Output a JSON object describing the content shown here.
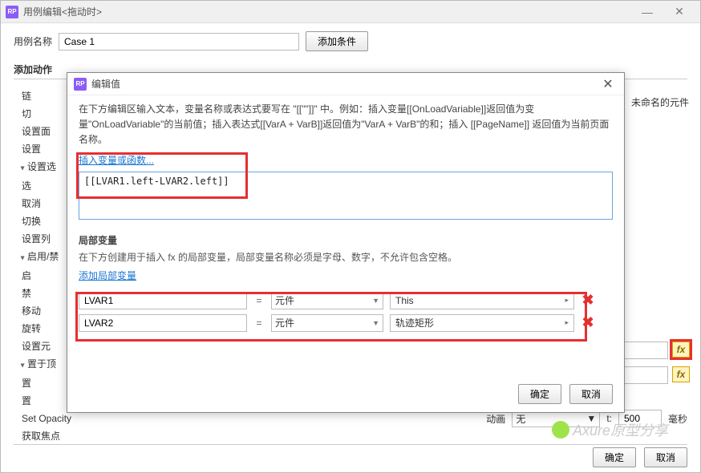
{
  "outer": {
    "title": "用例编辑<拖动时>",
    "caseNameLabel": "用例名称",
    "caseName": "Case 1",
    "addCondition": "添加条件",
    "addActionHdr": "添加动作",
    "componentsHdr": "未命名的元件",
    "ok": "确定",
    "cancel": "取消"
  },
  "tree": {
    "items": [
      "链",
      "切",
      "设置面",
      "设置",
      "设置选",
      "选",
      "取消",
      "切换",
      "设置列",
      "启用/禁",
      "启",
      "禁",
      "移动",
      "旋转",
      "设置元",
      "置于顶",
      "置",
      "置",
      "Set Opacity",
      "获取焦点"
    ]
  },
  "modal": {
    "title": "编辑值",
    "help": "在下方编辑区输入文本，变量名称或表达式要写在 \"[[\"\"]]\" 中。例如：插入变量[[OnLoadVariable]]返回值为变量\"OnLoadVariable\"的当前值；插入表达式[[VarA + VarB]]返回值为\"VarA + VarB\"的和；插入 [[PageName]] 返回值为当前页面名称。",
    "insertVarLink": "插入变量或函数...",
    "expression": "[[LVAR1.left-LVAR2.left]]",
    "localVarsHdr": "局部变量",
    "localVarsDesc": "在下方创建用于插入 fx 的局部变量，局部变量名称必须是字母、数字，不允许包含空格。",
    "addLocalVarLink": "添加局部变量",
    "vars": [
      {
        "name": "LVAR1",
        "type": "元件",
        "value": "This"
      },
      {
        "name": "LVAR2",
        "type": "元件",
        "value": "轨迹矩形"
      }
    ],
    "eq": "=",
    "ok": "确定",
    "cancel": "取消"
  },
  "anim": {
    "label": "动画",
    "value": "无",
    "tLabel": "t:",
    "tValue": "500",
    "ms": "毫秒"
  },
  "fx": "fx",
  "watermark": "Axure原型分享"
}
